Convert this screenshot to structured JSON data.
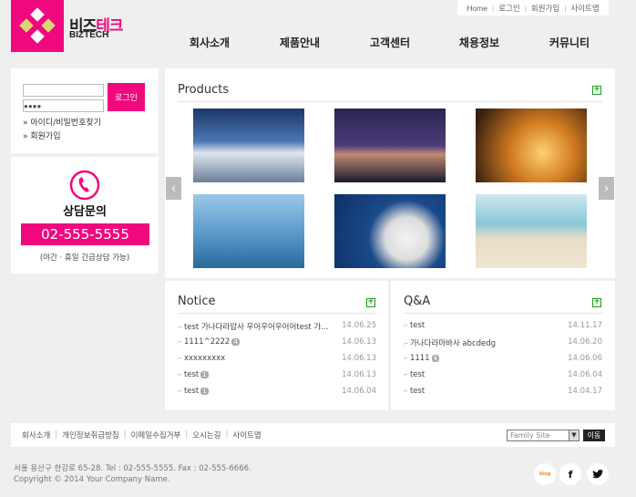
{
  "header": {
    "brand_black": "비즈",
    "brand_pink": "테크",
    "brand_sub": "BIZTECH",
    "top_links": [
      "Home",
      "로그인",
      "회원가입",
      "사이트맵"
    ],
    "nav": [
      "회사소개",
      "제품안내",
      "고객센터",
      "채용정보",
      "커뮤니티"
    ]
  },
  "login": {
    "password_mask": "●●●●",
    "button": "로그인",
    "find": "» 아이디/비밀번호찾기",
    "join": "» 회원가입"
  },
  "contact": {
    "title": "상담문의",
    "phone": "02-555-5555",
    "note": "(야간 · 휴일 긴급상담 가능)"
  },
  "products": {
    "title": "Products"
  },
  "notice": {
    "title": "Notice",
    "items": [
      {
        "title": "test 가나다라맙사 우어우어우어어test 가...",
        "badge": "",
        "date": "14.06.25"
      },
      {
        "title": "1111^2222",
        "badge": "4",
        "date": "14.06.13"
      },
      {
        "title": "xxxxxxxxx",
        "badge": "",
        "date": "14.06.13"
      },
      {
        "title": "test",
        "badge": "1",
        "date": "14.06.13"
      },
      {
        "title": "test",
        "badge": "1",
        "date": "14.06.04"
      }
    ]
  },
  "qna": {
    "title": "Q&A",
    "items": [
      {
        "title": "test",
        "badge": "",
        "date": "14.11.17"
      },
      {
        "title": "가나다라마바사 abcdedg",
        "badge": "",
        "date": "14.06.20"
      },
      {
        "title": "1111",
        "badge": "4",
        "date": "14.06.06"
      },
      {
        "title": "test",
        "badge": "",
        "date": "14.06.04"
      },
      {
        "title": "test",
        "badge": "",
        "date": "14.04.17"
      }
    ]
  },
  "footer": {
    "links": [
      "회사소개",
      "개인정보취급방침",
      "이메일수집거부",
      "오시는길",
      "사이트맵"
    ],
    "family_site": "Family Site",
    "go": "이동",
    "address": "서울 용산구 한강로 65-28. Tel : 02-555-5555.  Fax : 02-555-6666.",
    "copyright": "Copyright © 2014 Your Company Name.",
    "social": [
      "blog",
      "f",
      "t"
    ]
  }
}
